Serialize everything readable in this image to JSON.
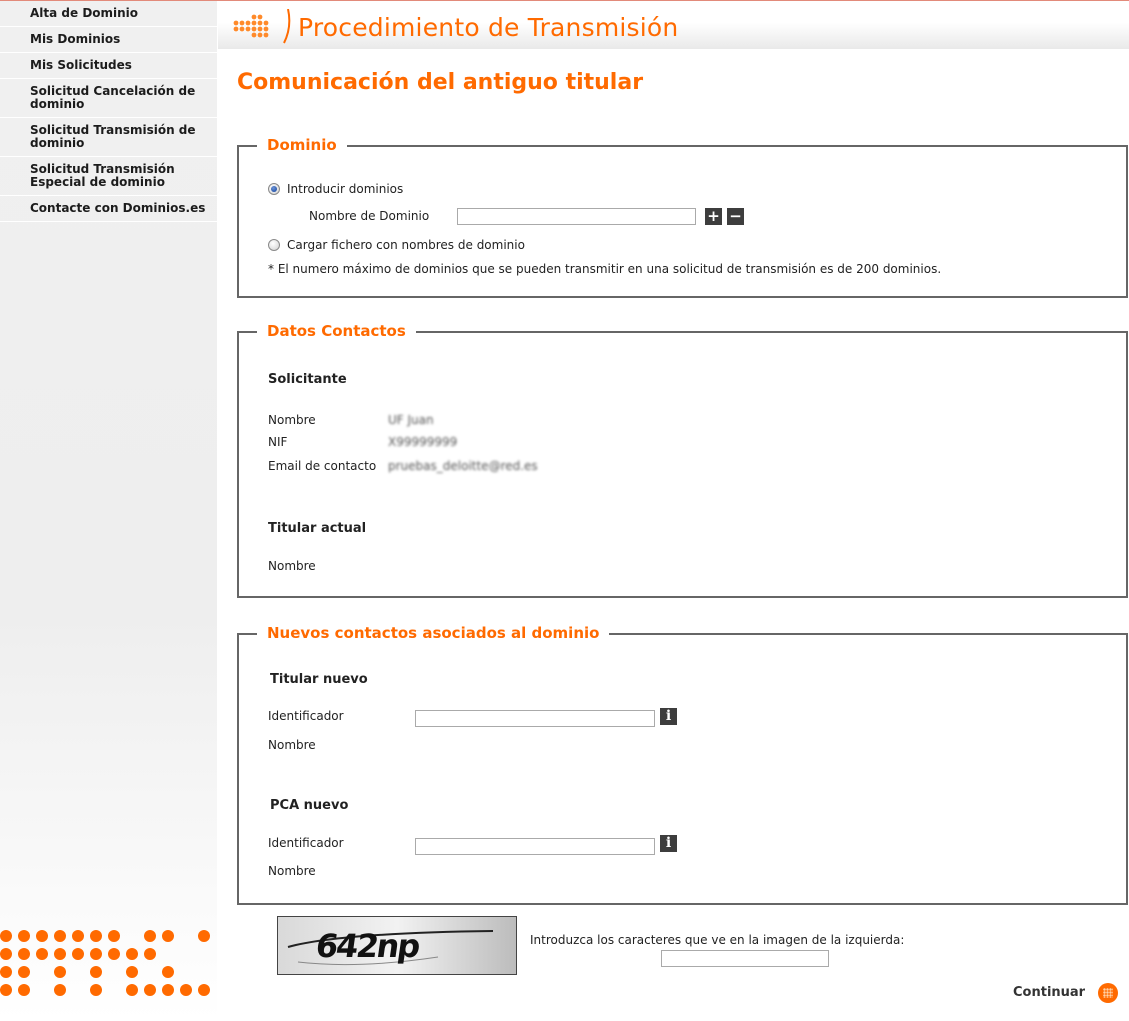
{
  "colors": {
    "accent": "#ff6a00",
    "border": "#666666"
  },
  "sidebar": {
    "items": [
      {
        "label": "Alta de Dominio"
      },
      {
        "label": "Mis Dominios"
      },
      {
        "label": "Mis Solicitudes"
      },
      {
        "label": "Solicitud Cancelación de dominio"
      },
      {
        "label": "Solicitud Transmisión de dominio"
      },
      {
        "label": "Solicitud Transmisión Especial de dominio"
      },
      {
        "label": "Contacte con Dominios.es"
      }
    ],
    "logo_icon": "dominios-dot-logo"
  },
  "header": {
    "title": "Procedimiento de Transmisión",
    "icon": "orange-arrow-icon"
  },
  "page_title": "Comunicación del antiguo titular",
  "dominio": {
    "legend": "Dominio",
    "radio_introducir": {
      "label": "Introducir dominios",
      "checked": true
    },
    "nombre_label": "Nombre de Dominio",
    "nombre_value": "",
    "add_button": "+",
    "remove_button": "−",
    "radio_cargar": {
      "label": "Cargar fichero con nombres de dominio",
      "checked": false
    },
    "note": "* El numero máximo de dominios que se pueden transmitir en una solicitud de transmisión es de 200 dominios."
  },
  "contactos": {
    "legend": "Datos Contactos",
    "solicitante_heading": "Solicitante",
    "nombre_label": "Nombre",
    "nombre_value": "UF Juan",
    "nif_label": "NIF",
    "nif_value": "X99999999",
    "email_label": "Email de contacto",
    "email_value": "pruebas_deloitte@red.es",
    "titular_heading": "Titular actual",
    "titular_nombre_label": "Nombre"
  },
  "nuevos": {
    "legend": "Nuevos contactos asociados al dominio",
    "titular_heading": "Titular nuevo",
    "titular_id_label": "Identificador",
    "titular_id_value": "",
    "titular_nombre_label": "Nombre",
    "pca_heading": "PCA nuevo",
    "pca_id_label": "Identificador",
    "pca_id_value": "",
    "pca_nombre_label": "Nombre",
    "info_button": "i"
  },
  "captcha": {
    "image_text": "642np",
    "prompt": "Introduzca los caracteres que ve en la imagen de la izquierda:",
    "value": ""
  },
  "continuar_label": "Continuar"
}
